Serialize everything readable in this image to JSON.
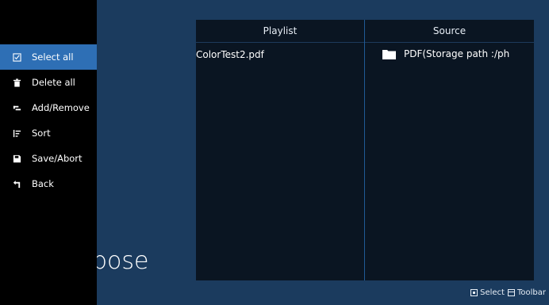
{
  "background": {
    "top_text": "                                     ",
    "bottom_text": "pose"
  },
  "sidebar": {
    "items": [
      {
        "label": "Select all",
        "icon": "select-all-icon"
      },
      {
        "label": "Delete all",
        "icon": "trash-icon"
      },
      {
        "label": "Add/Remove",
        "icon": "add-remove-icon"
      },
      {
        "label": "Sort",
        "icon": "sort-icon"
      },
      {
        "label": "Save/Abort",
        "icon": "save-icon"
      },
      {
        "label": "Back",
        "icon": "back-icon"
      }
    ]
  },
  "panel": {
    "playlist_header": "Playlist",
    "source_header": "Source",
    "playlist_items": [
      "ColorTest2.pdf"
    ],
    "source_items": [
      "PDF(Storage path :/ph"
    ]
  },
  "hints": {
    "select_label": "Select",
    "toolbar_label": "Toolbar"
  },
  "colors": {
    "background": "#1b3b5e",
    "sidebar": "#000000",
    "selected": "#2e6fb5",
    "panel": "#0a1522",
    "divider": "#1f5a96"
  }
}
